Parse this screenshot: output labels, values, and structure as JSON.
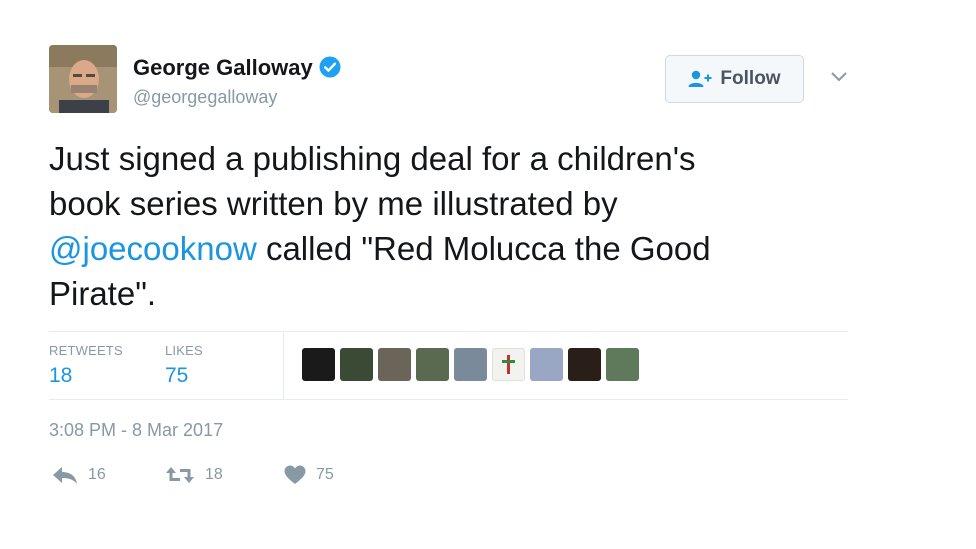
{
  "author": {
    "name": "George Galloway",
    "handle": "@georgegalloway",
    "verified": true,
    "avatar": "author-avatar-photo"
  },
  "follow_label": "Follow",
  "tweet": {
    "line1": "Just signed a publishing deal for a children's",
    "line2": "book series written by me illustrated by",
    "mention": "@joecooknow",
    "after_mention": " called \"Red Molucca the Good",
    "line4": "Pirate\"."
  },
  "stats": {
    "retweets_label": "RETWEETS",
    "retweets_value": "18",
    "likes_label": "LIKES",
    "likes_value": "75"
  },
  "liker_avatars": [
    "#1a1a1a",
    "#3b4a35",
    "#6b6458",
    "#5a6a50",
    "#7b8a9a",
    "#f2f2ee",
    "#9aa7c4",
    "#2a1e18",
    "#5f7a5a"
  ],
  "timestamp": "3:08 PM - 8 Mar 2017",
  "actions": {
    "reply_count": "16",
    "retweet_count": "18",
    "like_count": "75"
  },
  "colors": {
    "accent": "#1b95e0",
    "muted": "#8899a6",
    "text": "#14171a"
  }
}
